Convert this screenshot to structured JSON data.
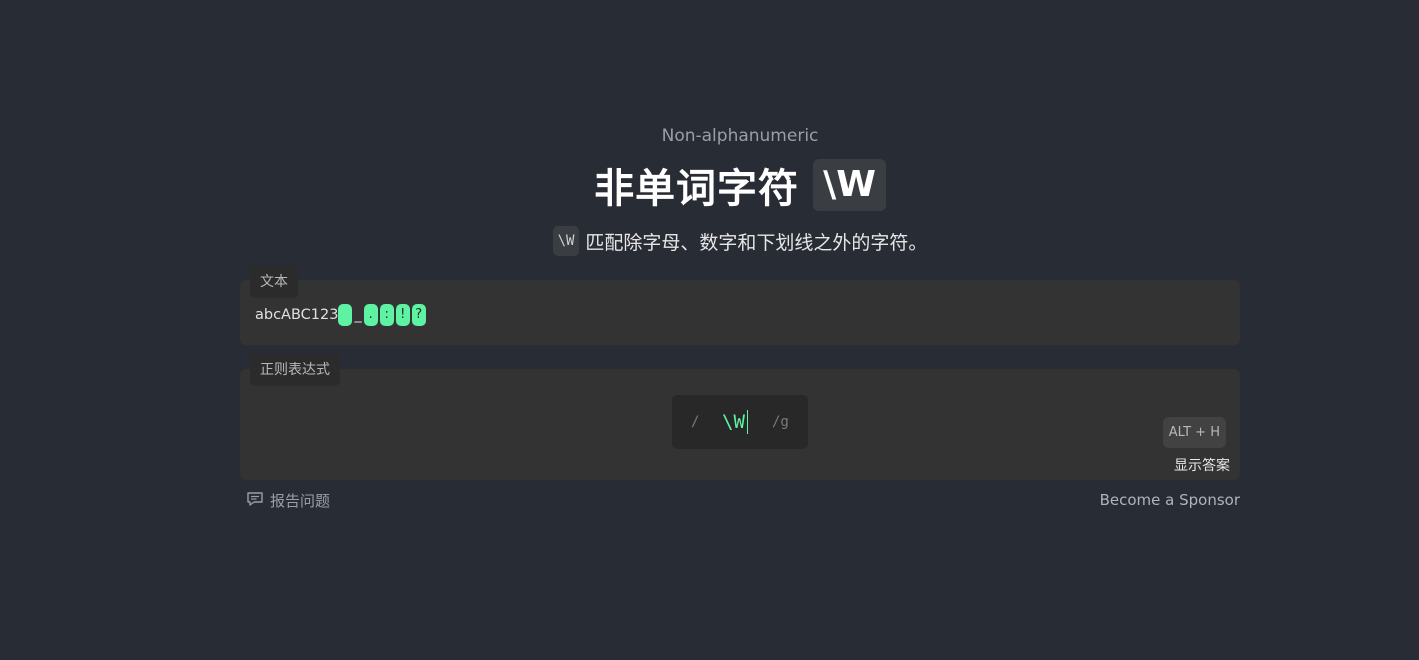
{
  "lesson": {
    "subtitle_en": "Non-alphanumeric",
    "title": "非单词字符",
    "title_code": "\\W",
    "description_code": "\\W",
    "description": "匹配除字母、数字和下划线之外的字符。"
  },
  "text_panel": {
    "label": "文本",
    "plain_prefix": "abcABC123",
    "segments": [
      {
        "text": " ",
        "highlighted": true
      },
      {
        "text": "_",
        "highlighted": false
      },
      {
        "text": ".",
        "highlighted": true
      },
      {
        "text": ":",
        "highlighted": true
      },
      {
        "text": "!",
        "highlighted": true
      },
      {
        "text": "?",
        "highlighted": true
      }
    ]
  },
  "regex_panel": {
    "label": "正则表达式",
    "open_delimiter": "/",
    "value": "\\W",
    "flags": "/g",
    "hint_shortcut": "ALT + H",
    "show_answer": "显示答案"
  },
  "footer": {
    "report_issue": "报告问题",
    "sponsor": "Become a Sponsor"
  },
  "colors": {
    "background": "#282c35",
    "panel": "#333333",
    "match_highlight": "#5ef3a2"
  },
  "icons": {
    "report": "comment-icon"
  }
}
